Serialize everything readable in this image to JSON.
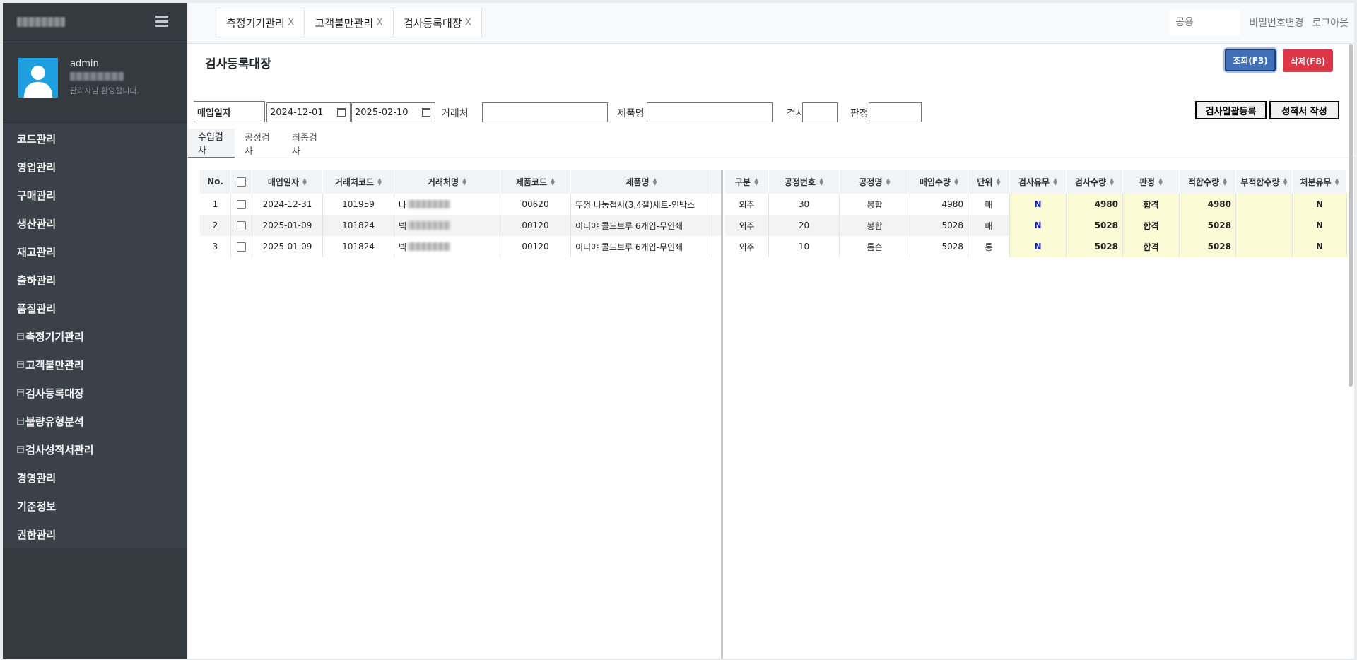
{
  "sidebar": {
    "user": {
      "name": "admin",
      "welcome": "관리자님 환영합니다."
    },
    "items": [
      {
        "label": "코드관리",
        "sub": false
      },
      {
        "label": "영업관리",
        "sub": false
      },
      {
        "label": "구매관리",
        "sub": false
      },
      {
        "label": "생산관리",
        "sub": false
      },
      {
        "label": "재고관리",
        "sub": false
      },
      {
        "label": "출하관리",
        "sub": false
      },
      {
        "label": "품질관리",
        "sub": false
      },
      {
        "label": "측정기기관리",
        "sub": true
      },
      {
        "label": "고객불만관리",
        "sub": true
      },
      {
        "label": "검사등록대장",
        "sub": true
      },
      {
        "label": "불량유형분석",
        "sub": true
      },
      {
        "label": "검사성적서관리",
        "sub": true
      },
      {
        "label": "경영관리",
        "sub": false
      },
      {
        "label": "기준정보",
        "sub": false
      },
      {
        "label": "권한관리",
        "sub": false
      }
    ]
  },
  "topbar": {
    "tabs": [
      {
        "label": "측정기기관리",
        "close": "X"
      },
      {
        "label": "고객불만관리",
        "close": "X"
      },
      {
        "label": "검사등록대장",
        "close": "X"
      }
    ],
    "public_placeholder": "공용",
    "change_password": "비밀번호변경",
    "logout": "로그아웃"
  },
  "page": {
    "title": "검사등록대장",
    "query_button": "조회(F3)",
    "delete_button": "삭제(F8)"
  },
  "filters": {
    "date_type": "매입일자",
    "date_from": "2024-12-01",
    "date_to": "2025-02-10",
    "customer_label": "거래처",
    "product_label": "제품명",
    "inspect_label": "검사",
    "verdict_label": "판정",
    "bulk_button": "검사일괄등록",
    "report_button": "성적서 작성"
  },
  "subtabs": [
    "수입검사",
    "공정검사",
    "최종검사"
  ],
  "grid": {
    "left_headers": [
      "No.",
      "",
      "매입일자",
      "거래처코드",
      "거래처명",
      "제품코드",
      "제품명"
    ],
    "right_headers": [
      "구분",
      "공정번호",
      "공정명",
      "매입수량",
      "단위",
      "검사유무",
      "검사수량",
      "판정",
      "적합수량",
      "부적합수량",
      "처분유무"
    ],
    "rows": [
      {
        "no": "1",
        "date": "2024-12-31",
        "cust_code": "101959",
        "cust_name_prefix": "나",
        "prod_code": "00620",
        "prod_name": "뚜껑 나눔접시(3,4절)세트-인박스",
        "type": "외주",
        "proc_no": "30",
        "proc_name": "봉합",
        "qty": "4980",
        "unit": "매",
        "inspect": "N",
        "insp_qty": "4980",
        "verdict": "합격",
        "ok_qty": "4980",
        "ng_qty": "",
        "dispose": "N"
      },
      {
        "no": "2",
        "date": "2025-01-09",
        "cust_code": "101824",
        "cust_name_prefix": "넥",
        "prod_code": "00120",
        "prod_name": "이디야 콜드브루 6개입-무인쇄",
        "type": "외주",
        "proc_no": "20",
        "proc_name": "봉합",
        "qty": "5028",
        "unit": "매",
        "inspect": "N",
        "insp_qty": "5028",
        "verdict": "합격",
        "ok_qty": "5028",
        "ng_qty": "",
        "dispose": "N"
      },
      {
        "no": "3",
        "date": "2025-01-09",
        "cust_code": "101824",
        "cust_name_prefix": "넥",
        "prod_code": "00120",
        "prod_name": "이디야 콜드브루 6개입-무인쇄",
        "type": "외주",
        "proc_no": "10",
        "proc_name": "톰슨",
        "qty": "5028",
        "unit": "통",
        "inspect": "N",
        "insp_qty": "5028",
        "verdict": "합격",
        "ok_qty": "5028",
        "ng_qty": "",
        "dispose": "N"
      }
    ]
  }
}
